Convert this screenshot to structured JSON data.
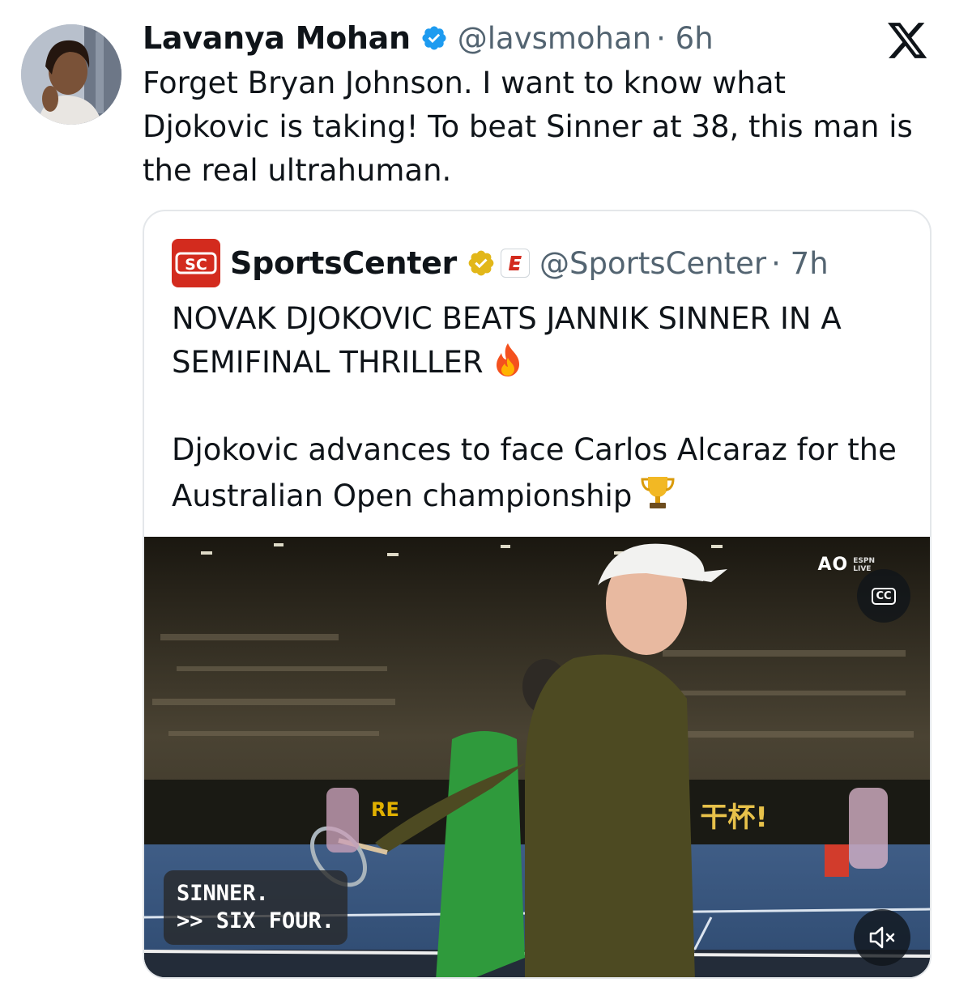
{
  "tweet": {
    "author_name": "Lavanya Mohan",
    "handle": "@lavsmohan",
    "time": "· 6h",
    "text": "Forget Bryan Johnson. I want to know what Djokovic is taking! To beat Sinner at 38, this man is the real ultrahuman."
  },
  "quoted": {
    "author_name": "SportsCenter",
    "handle": "@SportsCenter",
    "time": "· 7h",
    "line1": "NOVAK DJOKOVIC BEATS JANNIK SINNER IN A SEMIFINAL THRILLER",
    "line2": "Djokovic advances to face Carlos Alcaraz for the Australian Open championship",
    "video": {
      "caption": "SINNER.\n>> SIX FOUR.",
      "cc_label": "CC",
      "broadcast_logo": "AO",
      "broadcast_network": "ESPN",
      "broadcast_live": "LIVE"
    }
  },
  "icons": {
    "verified": "blue-verified-badge",
    "org_verified": "gold-verified-badge",
    "affiliate": "espn-affiliate-badge",
    "platform": "x-logo",
    "fire": "fire-emoji",
    "trophy": "trophy-emoji",
    "closed_captions": "cc-icon",
    "mute": "muted-speaker-icon"
  },
  "colors": {
    "blue_badge": "#1d9bf0",
    "gold_badge": "#e2b719",
    "brand_red": "#d32b1e",
    "secondary_text": "#536471"
  }
}
